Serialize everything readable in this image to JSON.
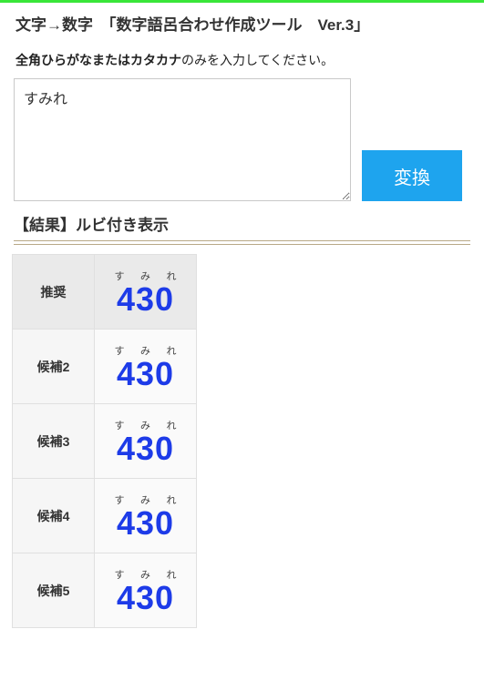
{
  "header": {
    "title": "文字→数字　「数字語呂合わせ作成ツール　Ver.3」"
  },
  "form": {
    "instruction_bold": "全角ひらがなまたはカタカナ",
    "instruction_rest": "のみを入力してください。",
    "textarea_value": "すみれ",
    "convert_label": "変換"
  },
  "results": {
    "heading": "【結果】ルビ付き表示",
    "rows": [
      {
        "label": "推奨",
        "ruby": [
          "す",
          "み",
          "れ"
        ],
        "number": "430"
      },
      {
        "label": "候補2",
        "ruby": [
          "す",
          "み",
          "れ"
        ],
        "number": "430"
      },
      {
        "label": "候補3",
        "ruby": [
          "す",
          "み",
          "れ"
        ],
        "number": "430"
      },
      {
        "label": "候補4",
        "ruby": [
          "す",
          "み",
          "れ"
        ],
        "number": "430"
      },
      {
        "label": "候補5",
        "ruby": [
          "す",
          "み",
          "れ"
        ],
        "number": "430"
      }
    ]
  }
}
